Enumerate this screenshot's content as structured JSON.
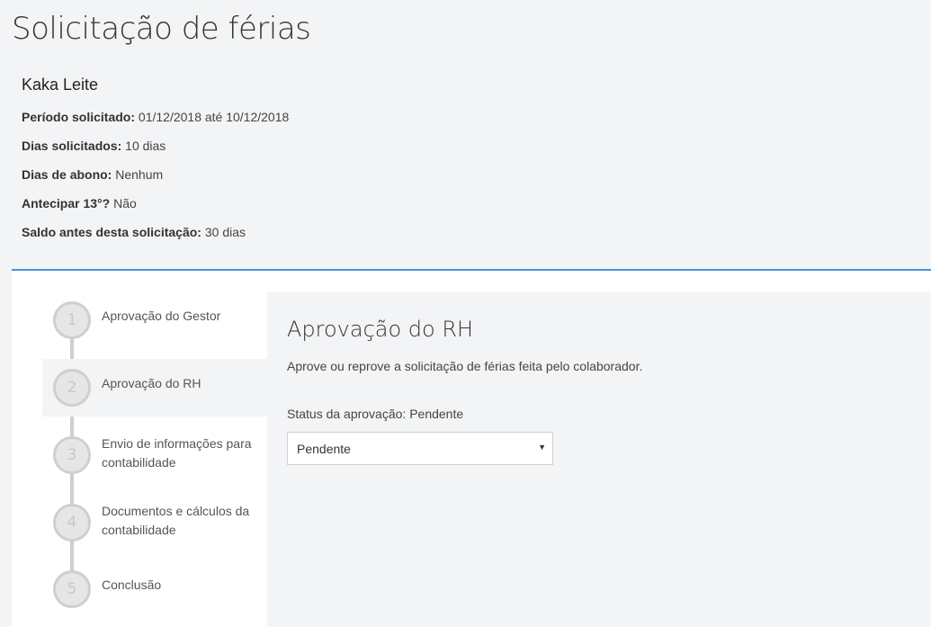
{
  "page": {
    "title": "Solicitação de férias"
  },
  "request": {
    "employee_name": "Kaka Leite",
    "fields": [
      {
        "label": "Período solicitado:",
        "value": "01/12/2018 até 10/12/2018"
      },
      {
        "label": "Dias solicitados:",
        "value": "10 dias"
      },
      {
        "label": "Dias de abono:",
        "value": "Nenhum"
      },
      {
        "label": "Antecipar 13°?",
        "value": "Não"
      },
      {
        "label": "Saldo antes desta solicitação:",
        "value": "30 dias"
      }
    ]
  },
  "steps": [
    {
      "number": "1",
      "line1": "Aprovação do Gestor",
      "line2": ""
    },
    {
      "number": "2",
      "line1": "Aprovação do RH",
      "line2": "",
      "active": true
    },
    {
      "number": "3",
      "line1": "Envio de informações para",
      "line2": "contabilidade"
    },
    {
      "number": "4",
      "line1": "Documentos e cálculos da",
      "line2": "contabilidade"
    },
    {
      "number": "5",
      "line1": "Conclusão",
      "line2": ""
    }
  ],
  "panel": {
    "title": "Aprovação do RH",
    "description": "Aprove ou reprove a solicitação de férias feita pelo colaborador.",
    "status_label": "Status da aprovação: Pendente",
    "select": {
      "selected": "Pendente",
      "icon": "caret-down-icon"
    }
  },
  "colors": {
    "accent": "#4a90d9",
    "background": "#f3f4f6"
  }
}
